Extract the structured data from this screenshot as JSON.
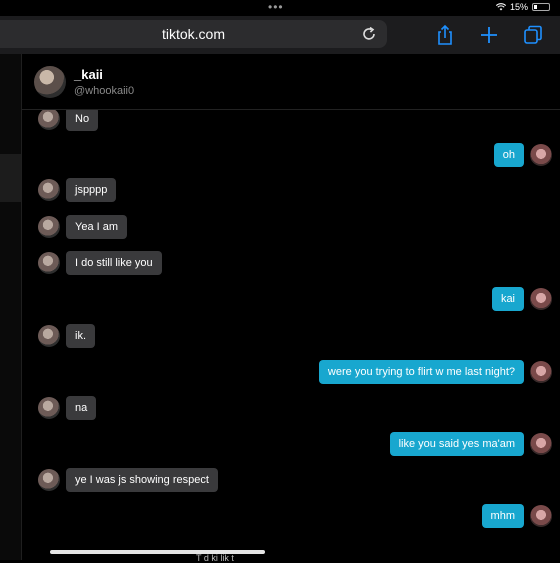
{
  "status": {
    "dots": "•••",
    "battery": "15%"
  },
  "browser": {
    "url": "tiktok.com"
  },
  "chat": {
    "name": "_kaii",
    "handle": "@whookaii0"
  },
  "messages": [
    {
      "dir": "in",
      "text": "No"
    },
    {
      "dir": "out",
      "text": "oh"
    },
    {
      "dir": "in",
      "text": "jspppp"
    },
    {
      "dir": "in",
      "text": "Yea I am"
    },
    {
      "dir": "in",
      "text": "I do still like you"
    },
    {
      "dir": "out",
      "text": "kai"
    },
    {
      "dir": "in",
      "text": "ik."
    },
    {
      "dir": "out",
      "text": "were you trying to flirt w me last night?"
    },
    {
      "dir": "in",
      "text": "na"
    },
    {
      "dir": "out",
      "text": "like you said yes ma'am"
    },
    {
      "dir": "in",
      "text": "ye I was js showing respect"
    },
    {
      "dir": "out",
      "text": "mhm"
    }
  ],
  "bottom_peek": "T       d                  ki   lik    t"
}
